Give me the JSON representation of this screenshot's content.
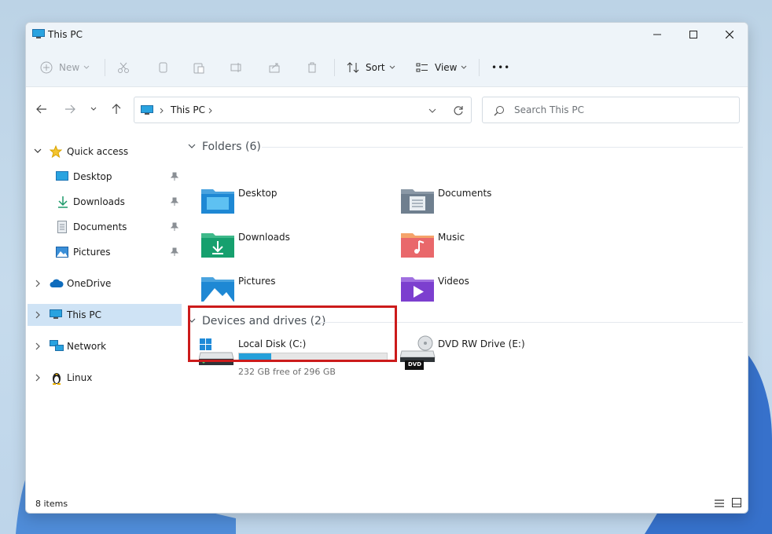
{
  "window": {
    "title": "This PC"
  },
  "toolbar": {
    "new_label": "New",
    "sort_label": "Sort",
    "view_label": "View",
    "more_label": "•••"
  },
  "address": {
    "crumb": "This PC"
  },
  "search": {
    "placeholder": "Search This PC"
  },
  "sidebar": {
    "items": [
      {
        "label": "Quick access"
      },
      {
        "label": "Desktop"
      },
      {
        "label": "Downloads"
      },
      {
        "label": "Documents"
      },
      {
        "label": "Pictures"
      },
      {
        "label": "OneDrive"
      },
      {
        "label": "This PC"
      },
      {
        "label": "Network"
      },
      {
        "label": "Linux"
      }
    ]
  },
  "content": {
    "folders_header": "Folders (6)",
    "folders": [
      {
        "label": "Desktop"
      },
      {
        "label": "Documents"
      },
      {
        "label": "Downloads"
      },
      {
        "label": "Music"
      },
      {
        "label": "Pictures"
      },
      {
        "label": "Videos"
      }
    ],
    "devices_header": "Devices and drives (2)",
    "drives": [
      {
        "label": "Local Disk (C:)",
        "free_text": "232 GB free of 296 GB",
        "used_fraction": 0.216
      },
      {
        "label": "DVD RW Drive (E:)",
        "badge": "DVD"
      }
    ]
  },
  "status": {
    "items_count": "8 items"
  },
  "colors": {
    "accent": "#26a0da",
    "highlight": "#cc1b1b",
    "selection": "#cfe3f5"
  }
}
